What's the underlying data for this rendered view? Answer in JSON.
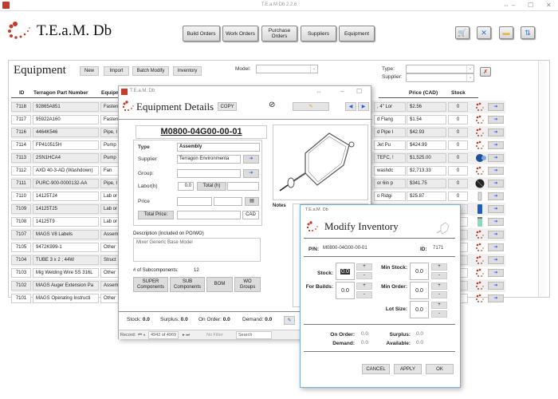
{
  "window": {
    "title": "T.E.a.M Db 2.2.6",
    "app_name": "T.E.a.M. Db"
  },
  "nav": {
    "buttons": [
      "Build Orders",
      "Work Orders",
      "Purchase Orders",
      "Suppliers",
      "Equipment"
    ],
    "icon_buttons": [
      "cart-icon",
      "tools-icon",
      "folder-icon",
      "refresh-icon"
    ]
  },
  "equipment": {
    "title": "Equipment",
    "toolbar": {
      "new": "New",
      "import": "Import",
      "batch_modify": "Batch Modify",
      "inventory": "Inventory"
    },
    "filters": {
      "model_label": "Model:",
      "type_label": "Type:",
      "supplier_label": "Supplier:",
      "model_value": "",
      "type_value": "",
      "supplier_value": ""
    },
    "columns": {
      "id": "ID",
      "part_number": "Terragon Part Number",
      "equipment": "Equipm",
      "price": "Price (CAD)",
      "stock": "Stock"
    },
    "rows": [
      {
        "id": "7118",
        "pn": "92865A851",
        "type": "Fasten",
        "desc": ", 4\" Lor",
        "price": "$2.56",
        "stock": "0",
        "icon": "team-logo"
      },
      {
        "id": "7117",
        "pn": "95922A160",
        "type": "Fasten",
        "desc": "d Flang",
        "price": "$1.54",
        "stock": "0",
        "icon": "team-logo"
      },
      {
        "id": "7116",
        "pn": "4464K546",
        "type": "Pipe, I",
        "desc": "d Pipe I",
        "price": "$42.93",
        "stock": "0",
        "icon": "team-logo"
      },
      {
        "id": "7114",
        "pn": "FP410515H",
        "type": "Pump",
        "desc": "Jet Pu",
        "price": "$424.99",
        "stock": "0",
        "icon": "team-logo"
      },
      {
        "id": "7113",
        "pn": "2SN1HCA4",
        "type": "Pump",
        "desc": "TEFC, !",
        "price": "$1,525.00",
        "stock": "0",
        "icon": "pump"
      },
      {
        "id": "7112",
        "pn": "AXD 40-3-AD (Washdown)",
        "type": "Fan",
        "desc": "washdc",
        "price": "$2,713.33",
        "stock": "0",
        "icon": "team-logo"
      },
      {
        "id": "7111",
        "pn": "PURC-900-0000132-AA",
        "type": "Pipe, I",
        "desc": "or 6in p",
        "price": "$341.75",
        "stock": "0",
        "icon": "fan"
      },
      {
        "id": "7110",
        "pn": "14125T24",
        "type": "Lab or",
        "desc": "o Ridgi",
        "price": "$25.87",
        "stock": "0",
        "icon": "filter"
      },
      {
        "id": "7109",
        "pn": "14125T25",
        "type": "Lab or",
        "desc": "",
        "price": "",
        "stock": "",
        "icon": "blue-bottle"
      },
      {
        "id": "7108",
        "pn": "14125T9",
        "type": "Lab or",
        "desc": "",
        "price": "",
        "stock": "",
        "icon": "green-bottle"
      },
      {
        "id": "7107",
        "pn": "MAGS V8 Labels",
        "type": "Assem",
        "desc": "",
        "price": "",
        "stock": "",
        "icon": "team-logo"
      },
      {
        "id": "7105",
        "pn": "9472K999-1",
        "type": "Other",
        "desc": "",
        "price": "",
        "stock": "",
        "icon": "team-logo"
      },
      {
        "id": "7104",
        "pn": "TUBE 3 x 2 ; 44W",
        "type": "Struct",
        "desc": "",
        "price": "",
        "stock": "",
        "icon": "team-logo"
      },
      {
        "id": "7103",
        "pn": "Mig Welding Wire SS 316L",
        "type": "Other",
        "desc": "",
        "price": "",
        "stock": "",
        "icon": "team-logo"
      },
      {
        "id": "7102",
        "pn": "MAGS Auger Extension Pa",
        "type": "Assem",
        "desc": "",
        "price": "",
        "stock": "",
        "icon": "team-logo"
      },
      {
        "id": "7101",
        "pn": "MAGS Operating Instructi",
        "type": "Other",
        "desc": "",
        "price": "",
        "stock": "",
        "icon": "team-logo"
      }
    ]
  },
  "details": {
    "window_title": "T.E.a.M. Db",
    "title": "Equipment Details",
    "copy": "COPY",
    "part_number": "M0800-04G00-00-01",
    "type_label": "Type",
    "type_value": "Assembly",
    "supplier_label": "Supplier",
    "supplier_value": "Terragon Environmenta",
    "group_label": "Group:",
    "group_value": "",
    "labor_label": "Labor(h)",
    "labor_value": "0.0",
    "total_h_label": "Total (h)",
    "total_h_value": "",
    "price_label": "Price",
    "price_value": "",
    "total_price_label": "Total Price:",
    "total_price_value": "",
    "currency": "CAD",
    "notes_label": "Notes",
    "description_label": "Description (included on PO/WO)",
    "description_value": "Mixer Generic Base Model",
    "subcomponents_label": "# of Subcomponents:",
    "subcomponents_value": "12",
    "buttons": {
      "super": "SUPER Components",
      "sub": "SUB Components",
      "bom": "BOM",
      "wo": "WO Groups"
    },
    "footer": {
      "stock_label": "Stock:",
      "stock": "0.0",
      "surplus_label": "Surplus:",
      "surplus": "0.0",
      "on_order_label": "On Order:",
      "on_order": "0.0",
      "demand_label": "Demand:",
      "demand": "0.0"
    },
    "record_bar": {
      "record_label": "Record:",
      "position": "4942 of 4969",
      "filter": "No Filter",
      "search": "Search"
    }
  },
  "inventory": {
    "window_title": "T.E.a.M. Db",
    "title": "Modify Inventory",
    "pn_label": "P/N:",
    "pn_value": "M0800-04G00-00-01",
    "id_label": "ID:",
    "id_value": "7171",
    "stock_label": "Stock:",
    "stock": "0.0",
    "for_builds_label": "For Builds:",
    "for_builds": "0.0",
    "min_stock_label": "Min Stock:",
    "min_stock": "0.0",
    "min_order_label": "Min Order:",
    "min_order": "0.0",
    "lot_size_label": "Lot Size:",
    "lot_size": "0.0",
    "on_order_label": "On Order:",
    "on_order": "0.0",
    "surplus_label": "Surplus:",
    "surplus": "0.0",
    "demand_label": "Demand:",
    "demand": "0.0",
    "available_label": "Available:",
    "available": "0.0",
    "buttons": {
      "cancel": "CANCEL",
      "apply": "APPLY",
      "ok": "OK"
    },
    "plus": "+",
    "minus": "-"
  },
  "colors": {
    "brand_red": "#c43a2c",
    "accent_blue": "#2a5bd7"
  }
}
